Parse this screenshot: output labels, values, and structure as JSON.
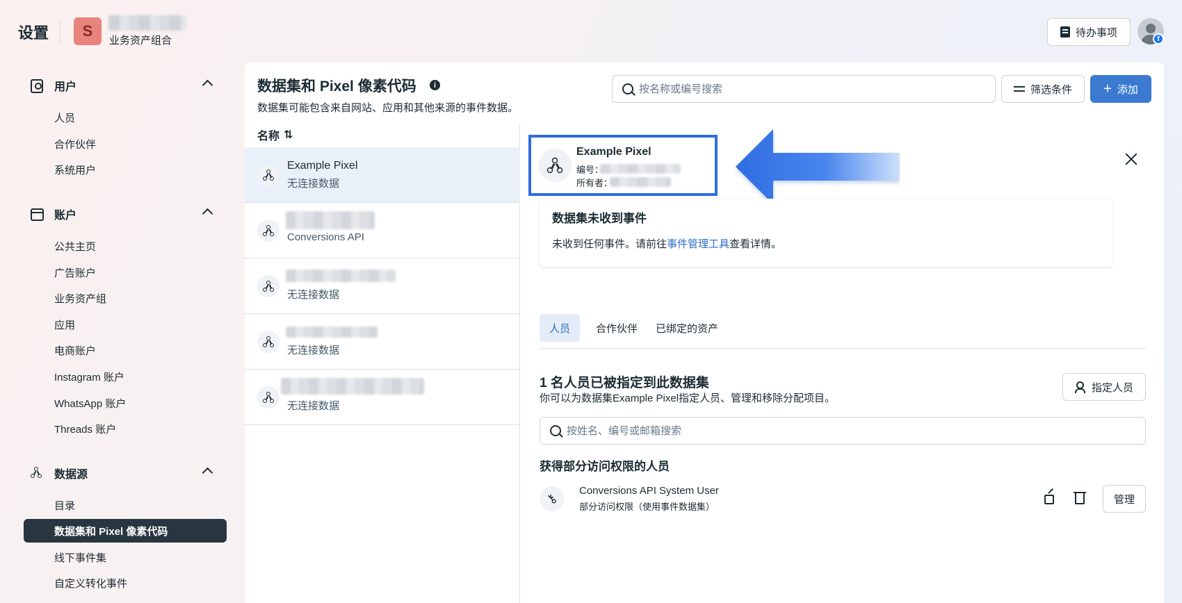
{
  "topbar": {
    "title": "设置",
    "business_initial": "S",
    "business_subtitle": "业务资产组合",
    "todo_label": "待办事项",
    "badge": "f"
  },
  "sidebar": {
    "sections": [
      {
        "title": "用户",
        "icon": "user-card-icon",
        "items": [
          "人员",
          "合作伙伴",
          "系统用户"
        ]
      },
      {
        "title": "账户",
        "icon": "archive-box-icon",
        "items": [
          "公共主页",
          "广告账户",
          "业务资产组",
          "应用",
          "电商账户",
          "Instagram 账户",
          "WhatsApp 账户",
          "Threads 账户"
        ]
      },
      {
        "title": "数据源",
        "icon": "data-source-icon",
        "items": [
          "目录",
          "数据集和 Pixel 像素代码",
          "线下事件集",
          "自定义转化事件"
        ]
      }
    ],
    "active_item": "数据集和 Pixel 像素代码"
  },
  "header": {
    "title": "数据集和 Pixel 像素代码",
    "subtitle": "数据集可能包含来自网站、应用和其他来源的事件数据。",
    "search_placeholder": "按名称或编号搜索",
    "filter_label": "筛选条件",
    "add_label": "添加"
  },
  "list": {
    "column_header": "名称",
    "sort_icon": "sort-arrows-icon",
    "rows": [
      {
        "name": "Example Pixel",
        "status": "无连接数据",
        "selected": true
      },
      {
        "name": "",
        "status": "Conversions API"
      },
      {
        "name": "",
        "status": "无连接数据"
      },
      {
        "name": "",
        "status": "无连接数据"
      },
      {
        "name": "",
        "status": "无连接数据"
      }
    ]
  },
  "detail": {
    "name": "Example Pixel",
    "id_label": "编号：",
    "owner_label": "所有者：",
    "notice_title": "数据集未收到事件",
    "notice_before": "未收到任何事件。请前往",
    "notice_link": "事件管理工具",
    "notice_after": "查看详情。",
    "tabs": [
      "人员",
      "合作伙伴",
      "已绑定的资产"
    ],
    "active_tab": "人员",
    "people_title": "1 名人员已被指定到此数据集",
    "people_sub": "你可以为数据集Example Pixel指定人员、管理和移除分配项目。",
    "assign_label": "指定人员",
    "people_search_placeholder": "按姓名、编号或邮箱搜索",
    "partial_title": "获得部分访问权限的人员",
    "member": {
      "name": "Conversions API System User",
      "access": "部分访问权限（使用事件数据集）",
      "manage_label": "管理"
    }
  },
  "colors": {
    "accent": "#3b7ad0",
    "highlight_border": "#2f6de1",
    "active_sidebar": "#283640",
    "link": "#2c6ec4"
  }
}
